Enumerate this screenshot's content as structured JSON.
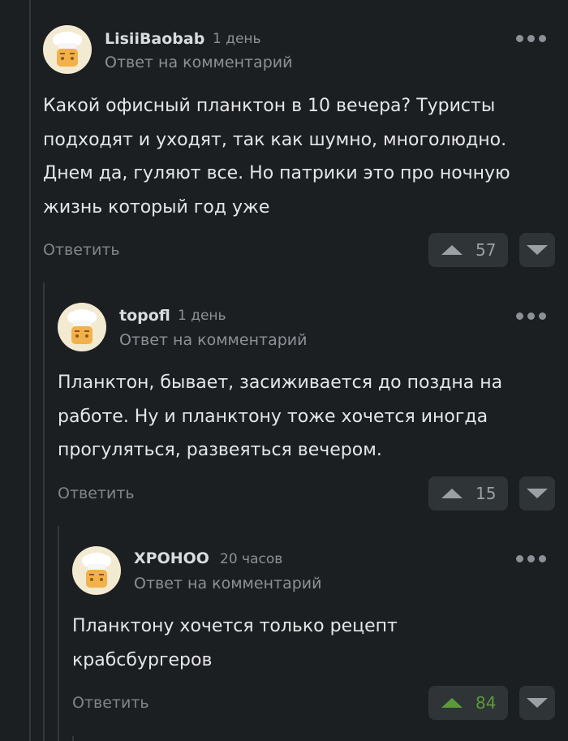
{
  "comments": [
    {
      "author": "LisiiBaobab",
      "time": "1 день",
      "reply_note": "Ответ на комментарий",
      "lines": [
        "Какой офисный планктон в 10 вечера? Туристы",
        "подходят и уходят, так как шумно, многолюдно.",
        "Днем да, гуляют все. Но патрики это про ночную",
        "жизнь который год уже"
      ],
      "reply_label": "Ответить",
      "rating": "57",
      "upvoted": false
    },
    {
      "author": "topofl",
      "time": "1 день",
      "reply_note": "Ответ на комментарий",
      "lines": [
        "Планктон, бывает, засиживается до поздна на",
        "работе. Ну и планктону тоже хочется иногда",
        "прогуляться, развеяться вечером."
      ],
      "reply_label": "Ответить",
      "rating": "15",
      "upvoted": false
    },
    {
      "author": "XPOHOO",
      "time": "20 часов",
      "reply_note": "Ответ на комментарий",
      "lines": [
        "Планктону хочется только рецепт",
        "крабсбургеров"
      ],
      "reply_label": "Ответить",
      "rating": "84",
      "upvoted": true
    }
  ],
  "icons": {
    "avatar": "chef-avatar-icon",
    "more": "more-dots-icon",
    "upvote": "upvote-arrow-icon",
    "downvote": "downvote-arrow-icon"
  },
  "colors": {
    "background": "#1c1f21",
    "upvoted_accent": "#5b9a3a",
    "button_bg": "#2f3437"
  }
}
